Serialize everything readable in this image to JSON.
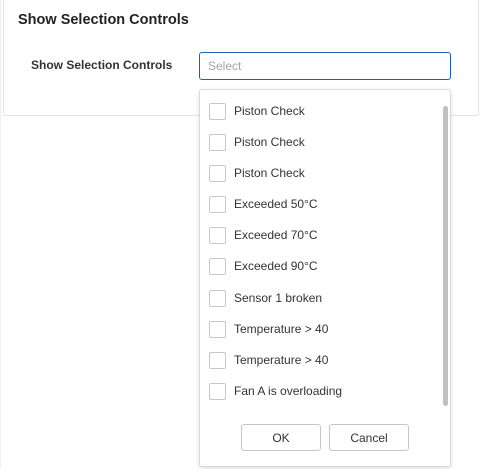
{
  "card": {
    "title": "Show Selection Controls",
    "field_label": "Show Selection Controls"
  },
  "select": {
    "placeholder": "Select",
    "value": ""
  },
  "options": [
    {
      "label": "Piston Check",
      "checked": false
    },
    {
      "label": "Piston Check",
      "checked": false
    },
    {
      "label": "Piston Check",
      "checked": false
    },
    {
      "label": "Exceeded 50°C",
      "checked": false
    },
    {
      "label": "Exceeded 70°C",
      "checked": false
    },
    {
      "label": "Exceeded 90°C",
      "checked": false
    },
    {
      "label": "Sensor 1 broken",
      "checked": false
    },
    {
      "label": "Temperature > 40",
      "checked": false
    },
    {
      "label": "Temperature > 40",
      "checked": false
    },
    {
      "label": "Fan A is overloading",
      "checked": false
    }
  ],
  "buttons": {
    "ok_label": "OK",
    "cancel_label": "Cancel"
  },
  "colors": {
    "accent_border": "#1f63b0",
    "checkbox_border": "#c8c8c8",
    "text": "#333333"
  }
}
